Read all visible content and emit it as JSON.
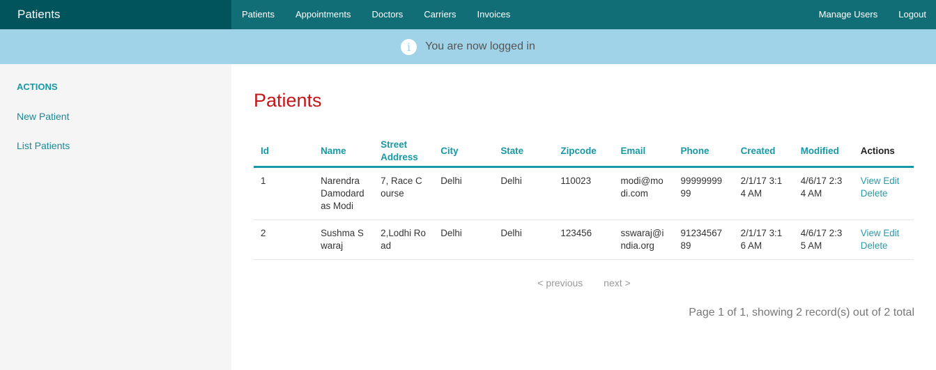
{
  "brand": "Patients",
  "nav": [
    "Patients",
    "Appointments",
    "Doctors",
    "Carriers",
    "Invoices"
  ],
  "nav_right": [
    "Manage Users",
    "Logout"
  ],
  "flash": {
    "icon": "info-icon",
    "message": "You are now logged in"
  },
  "sidebar": {
    "heading": "ACTIONS",
    "items": [
      "New Patient",
      "List Patients"
    ]
  },
  "page_title": "Patients",
  "table": {
    "headers": [
      "Id",
      "Name",
      "Street Address",
      "City",
      "State",
      "Zipcode",
      "Email",
      "Phone",
      "Created",
      "Modified",
      "Actions"
    ],
    "rows": [
      {
        "id": "1",
        "name": "Narendra Damodardas Modi",
        "street": "7, Race Course",
        "city": "Delhi",
        "state": "Delhi",
        "zip": "110023",
        "email": "modi@modi.com",
        "phone": "9999999999",
        "created": "2/1/17 3:14 AM",
        "modified": "4/6/17 2:34 AM"
      },
      {
        "id": "2",
        "name": "Sushma Swaraj",
        "street": "2,Lodhi Road",
        "city": "Delhi",
        "state": "Delhi",
        "zip": "123456",
        "email": "sswaraj@india.org",
        "phone": "9123456789",
        "created": "2/1/17 3:16 AM",
        "modified": "4/6/17 2:35 AM"
      }
    ],
    "actions": {
      "view": "View",
      "edit": "Edit",
      "delete": "Delete"
    }
  },
  "pagination": {
    "previous": "< previous",
    "next": "next >",
    "summary": "Page 1 of 1, showing 2 record(s) out of 2 total"
  }
}
